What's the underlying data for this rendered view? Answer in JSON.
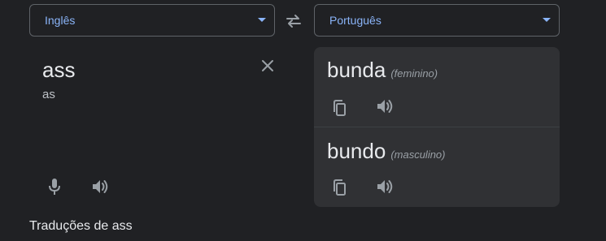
{
  "languages": {
    "source": "Inglês",
    "target": "Português"
  },
  "source": {
    "text": "ass",
    "transliteration": "as"
  },
  "results": [
    {
      "word": "bunda",
      "gender": "(feminino)"
    },
    {
      "word": "bundo",
      "gender": "(masculino)"
    }
  ],
  "translations_heading": "Traduções de ass",
  "colors": {
    "background": "#202124",
    "card": "#303134",
    "accent": "#8ab4f8",
    "icon": "#9aa0a6"
  },
  "icons": {
    "swap": "swap-arrows-icon",
    "clear": "close-icon",
    "mic": "microphone-icon",
    "speaker": "speaker-icon",
    "copy": "copy-icon",
    "caret": "caret-down-icon"
  }
}
